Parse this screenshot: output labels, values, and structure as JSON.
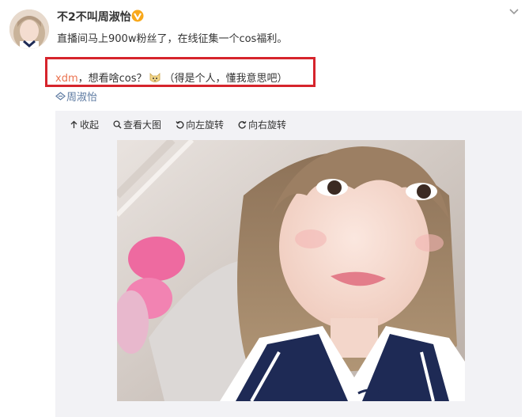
{
  "post": {
    "user_name": "不2不叫周淑怡",
    "text": "直播间马上900w粉丝了，在线征集一个cos福利。",
    "comment": {
      "user": "xdm",
      "text_before": "，想看啥cos？",
      "text_after": "（得是个人，懂我意思吧）",
      "emoji": "cat-face-emoji"
    },
    "mention": "周淑怡"
  },
  "toolbar": {
    "collapse_label": "收起",
    "view_large_label": "查看大图",
    "rotate_left_label": "向左旋转",
    "rotate_right_label": "向右旋转"
  },
  "colors": {
    "highlight_border": "#d6242c",
    "link": "#5d7aa1",
    "comment_user": "#eb7350",
    "media_bg": "#f2f2f5"
  }
}
